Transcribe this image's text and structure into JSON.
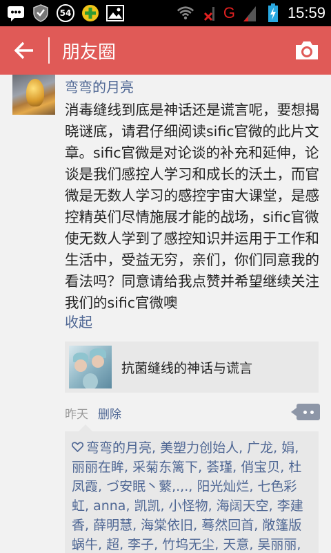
{
  "status_bar": {
    "notification_count": "54",
    "carrier_letter": "G",
    "time": "15:59"
  },
  "app_bar": {
    "title": "朋友圈"
  },
  "post": {
    "author": "弯弯的月亮",
    "text": "消毒缝线到底是神话还是谎言呢，要想揭晓谜底，请君仔细阅读sific官微的此片文章。sific官微是对论谈的补充和延伸，论谈是我们感控人学习和成长的沃土，而官微是无数人学习的感控宇宙大课堂，是感控精英们尽情施展才能的战场，sific官微使无数人学到了感控知识并运用于工作和生活中，受益无穷，亲们，你们同意我的看法吗？同意请给我点赞并希望继续关注我们的sific官微噢",
    "collapse_label": "收起",
    "link_title": "抗菌缝线的神话与谎言",
    "time": "昨天",
    "delete_label": "删除",
    "likes": "弯弯的月亮, 美塑力创始人, 广龙, 娟, 丽丽在眸, 采菊东篱下, 荟瑾, 俏宝贝, 杜凤霞, づ安眠丶蘩,.,., 阳光灿烂, 七色彩虹, anna, 凯凯, 小怪物, 海阔天空, 李建香, 薛明慧, 海棠依旧, 蓦然回首, 敞篷版蜗牛, 超, 李子, 竹坞无尘, 天意, 吴丽丽, 冉冉妈咪, 晴空, 桐桐妈, 泰"
  },
  "colors": {
    "app_bar": "#e05a57",
    "link_blue": "#4f6794"
  }
}
